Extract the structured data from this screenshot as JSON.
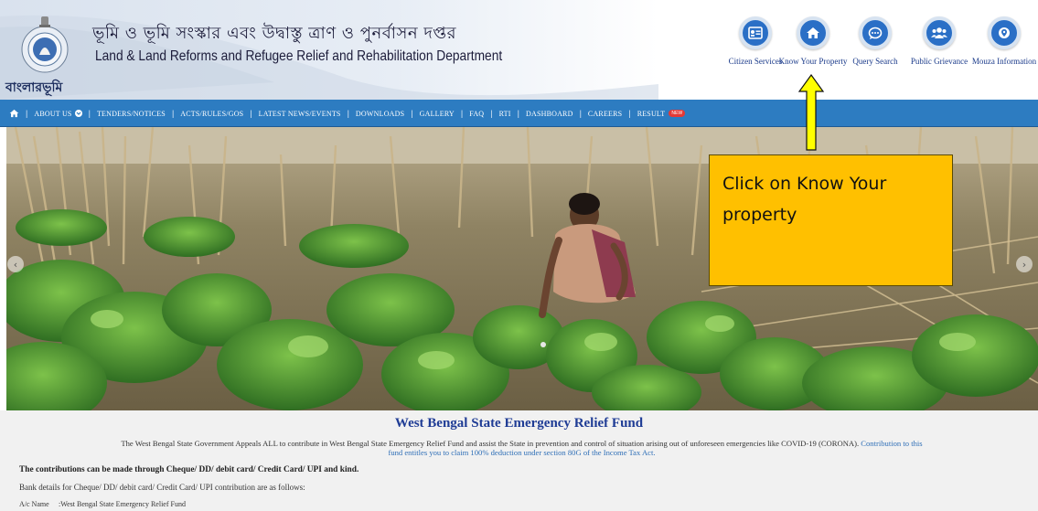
{
  "header": {
    "title_bn": "ভূমি ও ভূমি সংস্কার এবং উদ্বাস্তু ত্রাণ ও পুনর্বাসন দপ্তর",
    "title_en": "Land & Land Reforms and Refugee Relief and Rehabilitation Department",
    "brand": "বাংলারভূমি"
  },
  "quick_links": [
    {
      "label": "Citizen Services",
      "icon": "id-card-icon"
    },
    {
      "label": "Know Your Property",
      "icon": "home-icon"
    },
    {
      "label": "Query Search",
      "icon": "chat-icon"
    },
    {
      "label": "Public Grievance",
      "icon": "users-icon"
    },
    {
      "label": "Mouza Information",
      "icon": "location-icon"
    }
  ],
  "nav": {
    "items": [
      "ABOUT US",
      "TENDERS/NOTICES",
      "ACTS/RULES/GOS",
      "LATEST NEWS/EVENTS",
      "DOWNLOADS",
      "GALLERY",
      "FAQ",
      "RTI",
      "DASHBOARD",
      "CAREERS",
      "RESULT"
    ],
    "new_badge": "NEW"
  },
  "callout": {
    "line1": "Click on Know Your",
    "line2": "property"
  },
  "content": {
    "relief_title": "West Bengal State Emergency Relief Fund",
    "appeal_text": "The West Bengal State Government Appeals ALL to contribute in West Bengal State Emergency Relief Fund and assist the State in prevention and control of situation arising out of unforeseen emergencies like COVID-19 (CORONA).",
    "appeal_link_1": "Contribution to this",
    "appeal_link_2": "fund entitles you to claim 100% deduction under section 80G of the Income Tax Act.",
    "contributions": "The contributions can be made through Cheque/ DD/ debit card/ Credit Card/ UPI and kind.",
    "bank_details": "Bank details for Cheque/ DD/ debit card/ Credit Card/ UPI contribution are as follows:",
    "ac_name_label": "A/c Name",
    "ac_name_value": ":West Bengal State Emergency Relief Fund"
  },
  "colors": {
    "nav_bg": "#2d7cc1",
    "icon_bg": "#2a6fc6",
    "callout_bg": "#ffc000",
    "arrow": "#ffff00",
    "title_blue": "#1f3c95"
  }
}
